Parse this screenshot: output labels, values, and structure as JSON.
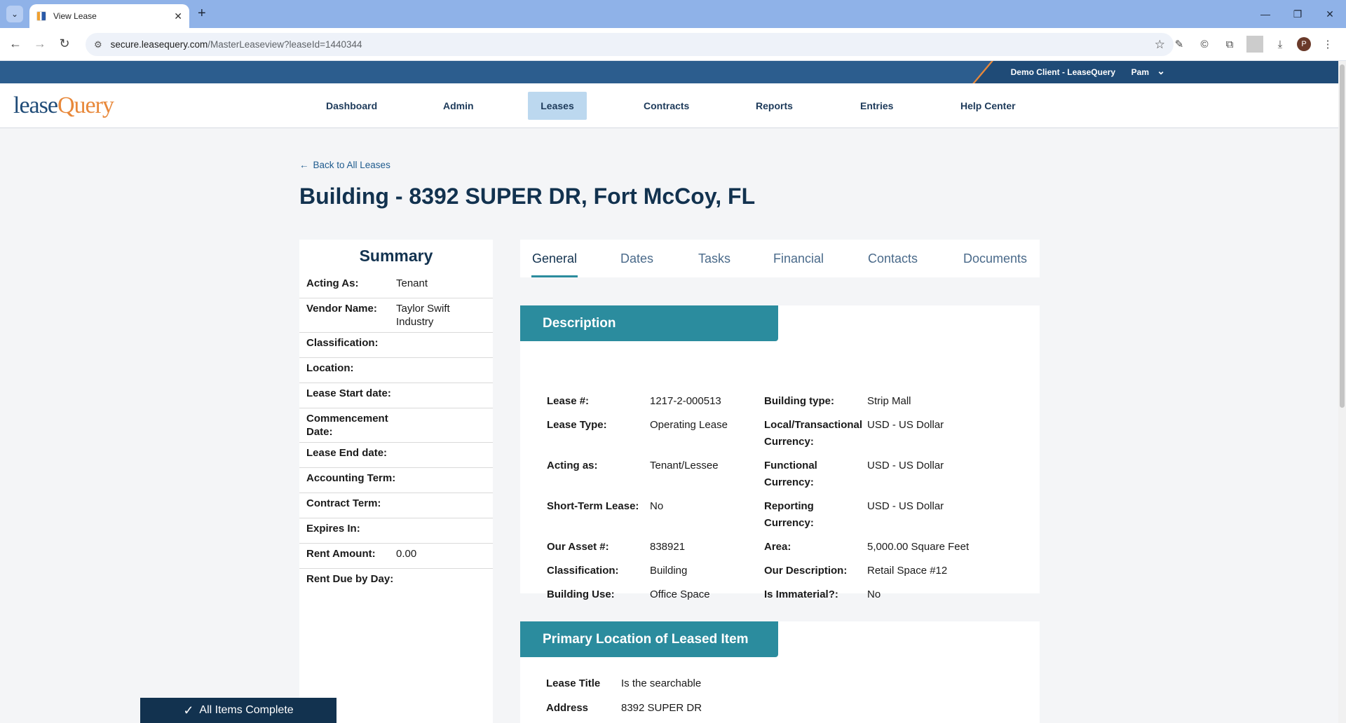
{
  "browser": {
    "tab_title": "View Lease",
    "url_host": "secure.leasequery.com",
    "url_path": "/MasterLeaseview?leaseId=1440344",
    "profile_initial": "P"
  },
  "header": {
    "client_name": "Demo Client - LeaseQuery",
    "user_name": "Pam",
    "logo_lease": "lease",
    "logo_query": "Query"
  },
  "nav": {
    "items": [
      "Dashboard",
      "Admin",
      "Leases",
      "Contracts",
      "Reports",
      "Entries",
      "Help Center"
    ],
    "active": "Leases"
  },
  "page": {
    "back_link": "Back to All Leases",
    "title": "Building - 8392 SUPER DR, Fort McCoy, FL"
  },
  "summary": {
    "title": "Summary",
    "rows": [
      {
        "label": "Acting As:",
        "value": "Tenant"
      },
      {
        "label": "Vendor Name:",
        "value": "Taylor Swift Industry"
      },
      {
        "label": "Classification:",
        "value": ""
      },
      {
        "label": "Location:",
        "value": ""
      },
      {
        "label": "Lease Start date:",
        "value": ""
      },
      {
        "label": "Commencement Date:",
        "value": ""
      },
      {
        "label": "Lease End date:",
        "value": ""
      },
      {
        "label": "Accounting Term:",
        "value": ""
      },
      {
        "label": "Contract Term:",
        "value": ""
      },
      {
        "label": "Expires In:",
        "value": ""
      },
      {
        "label": "Rent Amount:",
        "value": "0.00"
      },
      {
        "label": "Rent Due by Day:",
        "value": ""
      }
    ]
  },
  "tabs": [
    "General",
    "Dates",
    "Tasks",
    "Financial",
    "Contacts",
    "Documents"
  ],
  "active_tab": "General",
  "description": {
    "title": "Description",
    "left": [
      {
        "label": "Lease #:",
        "value": "1217-2-000513"
      },
      {
        "label": "Lease Type:",
        "value": "Operating Lease"
      },
      {
        "label": "Acting as:",
        "value": "Tenant/Lessee"
      },
      {
        "label": "Short-Term Lease:",
        "value": "No"
      },
      {
        "label": "Our Asset #:",
        "value": "838921"
      },
      {
        "label": "Classification:",
        "value": "Building"
      },
      {
        "label": "Building Use:",
        "value": "Office Space"
      }
    ],
    "right": [
      {
        "label": "Building type:",
        "value": "Strip Mall"
      },
      {
        "label": "Local/Transactional Currency:",
        "value": "USD - US Dollar"
      },
      {
        "label": "Functional Currency:",
        "value": "USD - US Dollar"
      },
      {
        "label": "Reporting Currency:",
        "value": "USD - US Dollar"
      },
      {
        "label": "Area:",
        "value": "5,000.00 Square Feet"
      },
      {
        "label": "Our Description:",
        "value": "Retail Space #12"
      },
      {
        "label": "Is Immaterial?:",
        "value": "No"
      }
    ]
  },
  "location": {
    "title": "Primary Location of Leased Item",
    "rows": [
      {
        "label": "Lease Title",
        "value": "Is the searchable"
      },
      {
        "label": "Address",
        "value": "8392 SUPER DR"
      }
    ]
  },
  "toast": {
    "text": "All Items Complete"
  }
}
